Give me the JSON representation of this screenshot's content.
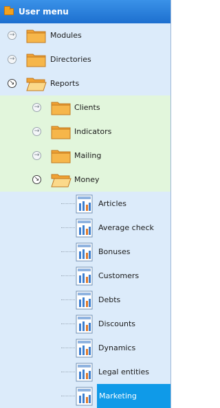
{
  "header": {
    "title": "User menu"
  },
  "tree": {
    "modules": {
      "label": "Modules"
    },
    "directories": {
      "label": "Directories"
    },
    "reports": {
      "label": "Reports"
    },
    "clients": {
      "label": "Clients"
    },
    "indicators": {
      "label": "Indicators"
    },
    "mailing": {
      "label": "Mailing"
    },
    "money": {
      "label": "Money"
    },
    "money_items": [
      {
        "label": "Articles"
      },
      {
        "label": "Average check"
      },
      {
        "label": "Bonuses"
      },
      {
        "label": "Customers"
      },
      {
        "label": "Debts"
      },
      {
        "label": "Discounts"
      },
      {
        "label": "Dynamics"
      },
      {
        "label": "Legal entities"
      },
      {
        "label": "Marketing"
      }
    ],
    "selected": "Marketing"
  },
  "colors": {
    "header": "#1d6fcf",
    "level0_row": "#dcebfa",
    "level1_row": "#e2f6dc",
    "selection": "#0f9ae8"
  }
}
